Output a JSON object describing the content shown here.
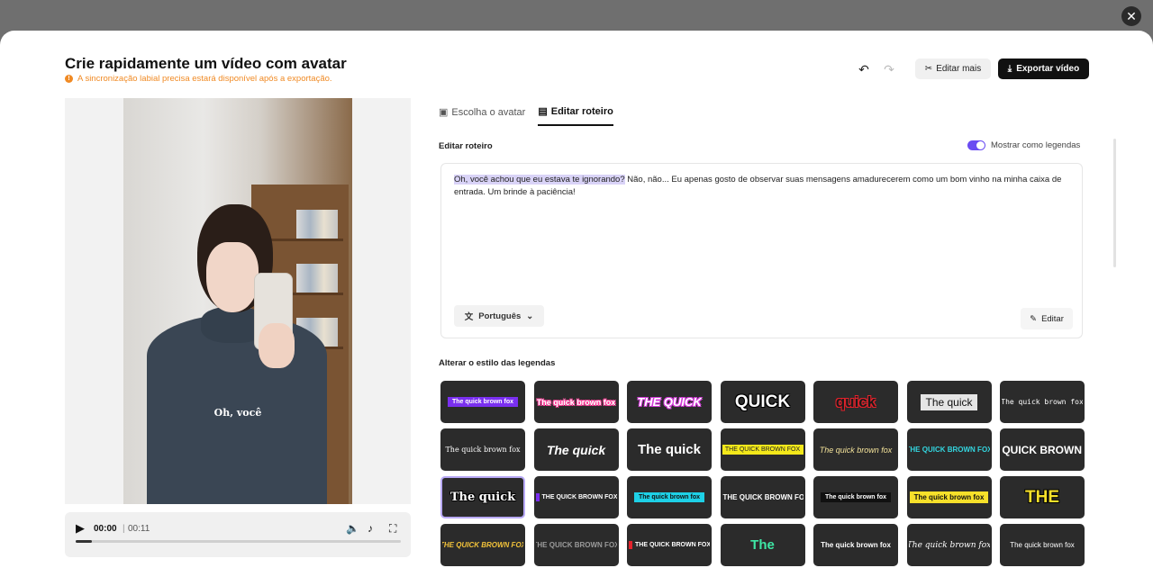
{
  "modal": {
    "title": "Crie rapidamente um vídeo com avatar",
    "warning": "A sincronização labial precisa estará disponível após a exportação.",
    "close_icon": "close-icon"
  },
  "toolbar": {
    "edit_more_label": "Editar mais",
    "export_label": "Exportar vídeo"
  },
  "video": {
    "caption": "Oh, você",
    "current_time": "00:00",
    "duration": "00:11",
    "progress": 0.05
  },
  "tabs": [
    {
      "label": "Escolha o avatar",
      "active": false
    },
    {
      "label": "Editar roteiro",
      "active": true
    }
  ],
  "script": {
    "section_label": "Editar roteiro",
    "toggle_label": "Mostrar como legendas",
    "toggle_on": true,
    "highlighted": "Oh, você achou que eu estava te ignorando?",
    "rest": " Não, não... Eu apenas gosto de observar suas mensagens amadurecerem como um bom vinho na minha caixa de entrada. Um brinde à paciência!",
    "language": "Português",
    "edit_label": "Editar"
  },
  "styles": {
    "section_label": "Alterar o estilo das legendas",
    "accent": "#6a4cf2",
    "tiles": [
      {
        "text": "The quick brown fox",
        "fg": "#ffffff",
        "bg": "#7a2ff0",
        "weight": "bold",
        "font": "sans",
        "size": 7
      },
      {
        "text": "The quick brown fox",
        "fg": "#ffffff",
        "bg": "",
        "weight": "bold",
        "font": "sans",
        "size": 9,
        "stroke": "#ff3e9a"
      },
      {
        "text": "THE QUICK",
        "fg": "#ffffff",
        "bg": "",
        "weight": "bold",
        "font": "sans",
        "size": 13,
        "italic": true,
        "stroke": "#d33bd9"
      },
      {
        "text": "QUICK",
        "fg": "#ffffff",
        "bg": "",
        "weight": "bold",
        "font": "sans",
        "size": 19,
        "stroke": "#000000"
      },
      {
        "text": "quick",
        "fg": "#1a1a1a",
        "bg": "",
        "weight": "bold",
        "font": "sans",
        "size": 17,
        "stroke": "#e2222b"
      },
      {
        "text": "The quick",
        "fg": "#111111",
        "bg": "#e5e5e5",
        "weight": "normal",
        "font": "sans",
        "size": 12
      },
      {
        "text": "The quick brown fox",
        "fg": "#ffffff",
        "bg": "",
        "weight": "normal",
        "font": "mono",
        "size": 8
      },
      {
        "text": "The quick brown fox",
        "fg": "#ffffff",
        "bg": "",
        "weight": "normal",
        "font": "serif",
        "size": 8
      },
      {
        "text": "The quick",
        "fg": "#ffffff",
        "bg": "",
        "weight": "bold",
        "font": "sans",
        "size": 14,
        "italic": true
      },
      {
        "text": "The quick",
        "fg": "#ffffff",
        "bg": "",
        "weight": "bold",
        "font": "sans",
        "size": 15
      },
      {
        "text": "THE QUICK BROWN FOX",
        "fg": "#222222",
        "bg": "#f3e81a",
        "weight": "normal",
        "font": "sans",
        "size": 7
      },
      {
        "text": "The quick brown fox",
        "fg": "#f4e39a",
        "bg": "",
        "weight": "normal",
        "font": "sans",
        "size": 9,
        "italic": true
      },
      {
        "text": "THE QUICK BROWN FOX",
        "fg": "#33d6e0",
        "bg": "",
        "weight": "bold",
        "font": "sans",
        "size": 8
      },
      {
        "text": "THE QUICK BROWN FOX",
        "fg": "#ffffff",
        "bg": "",
        "weight": "bold",
        "font": "sans",
        "size": 12
      },
      {
        "text": "The quick",
        "fg": "#ffffff",
        "bg": "",
        "weight": "bold",
        "font": "serif",
        "size": 13,
        "stroke": "#000000"
      },
      {
        "text": "THE QUICK BROWN FOX",
        "fg": "#ffffff",
        "bg": "",
        "weight": "bold",
        "font": "sans",
        "size": 7,
        "mark": "#7a2ff0"
      },
      {
        "text": "The quick brown fox",
        "fg": "#111111",
        "bg": "#1ed0e6",
        "weight": "bold",
        "font": "sans",
        "size": 7
      },
      {
        "text": "THE QUICK BROWN FOX",
        "fg": "#ffffff",
        "bg": "",
        "weight": "bold",
        "font": "sans",
        "size": 8,
        "mark": "#7a2ff0"
      },
      {
        "text": "The quick brown fox",
        "fg": "#ffffff",
        "bg": "#111111",
        "weight": "bold",
        "font": "sans",
        "size": 7
      },
      {
        "text": "The quick brown fox",
        "fg": "#111111",
        "bg": "#f6e02a",
        "weight": "bold",
        "font": "sans",
        "size": 8
      },
      {
        "text": "THE",
        "fg": "#f6e02a",
        "bg": "",
        "weight": "bold",
        "font": "sans",
        "size": 19,
        "stroke": "#000000"
      },
      {
        "text": "THE QUICK BROWN FOX",
        "fg": "#f3c33a",
        "bg": "",
        "weight": "bold",
        "font": "sans",
        "size": 8,
        "italic": true
      },
      {
        "text": "THE QUICK BROWN FOX",
        "fg": "#9a9a9a",
        "bg": "",
        "weight": "bold",
        "font": "sans",
        "size": 8
      },
      {
        "text": "THE QUICK BROWN FOX",
        "fg": "#ffffff",
        "bg": "",
        "weight": "bold",
        "font": "sans",
        "size": 7,
        "mark": "#e2222b"
      },
      {
        "text": "The",
        "fg": "#3ee7a5",
        "bg": "",
        "weight": "bold",
        "font": "sans",
        "size": 15
      },
      {
        "text": "The quick brown fox",
        "fg": "#ffffff",
        "bg": "",
        "weight": "bold",
        "font": "sans",
        "size": 8
      },
      {
        "text": "The quick brown fox",
        "fg": "#ffffff",
        "bg": "",
        "weight": "normal",
        "font": "serif",
        "size": 9,
        "italic": true
      },
      {
        "text": "The quick brown fox",
        "fg": "#ffffff",
        "bg": "",
        "weight": "normal",
        "font": "sans",
        "size": 8
      }
    ],
    "selected_index": 14
  }
}
